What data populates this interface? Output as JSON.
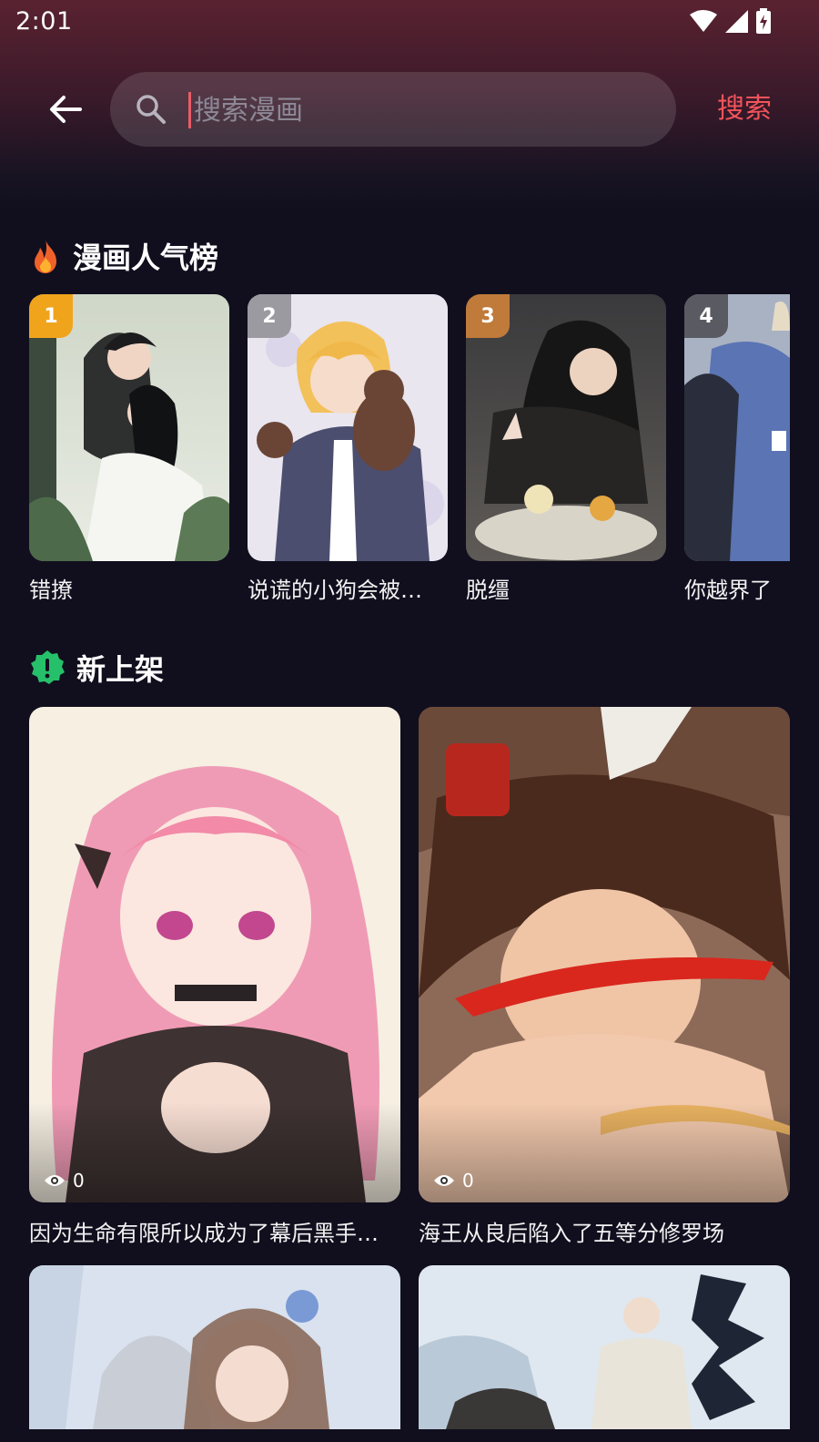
{
  "status_bar": {
    "time": "2:01"
  },
  "search": {
    "placeholder": "搜索漫画",
    "value": "",
    "submit_label": "搜索"
  },
  "ranking": {
    "title": "漫画人气榜",
    "items": [
      {
        "rank": "1",
        "title": "错撩",
        "badge_color": "#f0a41c"
      },
      {
        "rank": "2",
        "title": "说谎的小狗会被吃掉",
        "badge_color": "#9a9aa0"
      },
      {
        "rank": "3",
        "title": "脱缰",
        "badge_color": "#c07a3a"
      },
      {
        "rank": "4",
        "title": "你越界了",
        "badge_color": "#5a5a62"
      }
    ]
  },
  "new_releases": {
    "title": "新上架",
    "items": [
      {
        "title": "因为生命有限所以成为了幕后黑手的继承人",
        "views": "0"
      },
      {
        "title": "海王从良后陷入了五等分修罗场",
        "views": "0"
      },
      {
        "title": "",
        "views": ""
      },
      {
        "title": "",
        "views": ""
      }
    ]
  },
  "colors": {
    "accent": "#f2545b",
    "background": "#110f1e",
    "badge_green": "#27c06a"
  }
}
